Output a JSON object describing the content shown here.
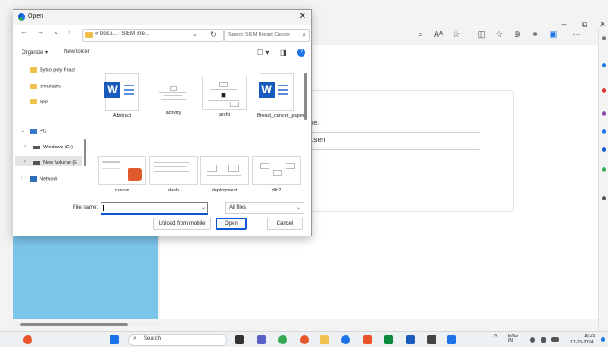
{
  "dialog": {
    "title": "Open",
    "close_glyph": "✕",
    "nav": {
      "back": "←",
      "forward": "→",
      "dropdown": "⌄",
      "up": "↑"
    },
    "address": "« Docu... › SIEM Bre...",
    "address_chevron": "⌄",
    "refresh_glyph": "↻",
    "search_placeholder": "Search SIEM Breast Cancer",
    "search_glyph": "⌕",
    "organize": "Organize ▾",
    "new_folder": "New folder",
    "view_glyphs": [
      "☐ ▾",
      "◨"
    ],
    "help_glyph": "?",
    "nav_items": [
      "Bytco poly Pract",
      "templates",
      "app",
      "PC",
      "Windows (C:)",
      "New Volume (E",
      "Network"
    ],
    "nav_chevrons": [
      "⌄",
      "›",
      "›",
      "›"
    ],
    "files": [
      {
        "name": "Abstract",
        "kind": "word"
      },
      {
        "name": "activity",
        "kind": "diagram"
      },
      {
        "name": "archi",
        "kind": "diagram"
      },
      {
        "name": "Breast_cancer_paper",
        "kind": "word"
      },
      {
        "name": "cancer",
        "kind": "slide"
      },
      {
        "name": "dash",
        "kind": "doc"
      },
      {
        "name": "deployment",
        "kind": "doc"
      },
      {
        "name": "dfd2",
        "kind": "doc"
      }
    ],
    "file_name_label": "File name:",
    "file_name_value": "",
    "file_type": "All files",
    "dropdown_glyph": "⌄",
    "upload_btn": "Upload from mobile",
    "open_btn": "Open",
    "cancel_btn": "Cancel"
  },
  "browser": {
    "controls": [
      "–",
      "⧉",
      "✕"
    ],
    "toolbar_icons": [
      "⌕",
      "Aᴬ",
      "☆",
      "◫",
      "☆",
      "⊕",
      "⚭",
      "▣",
      "⋯"
    ],
    "card_fragment": "re.",
    "input_fragment": "osen"
  },
  "taskbar": {
    "search_label": "Search",
    "search_glyph": "⌕",
    "tray_chevron": "^",
    "lang": "ENG IN",
    "time": "16:29",
    "date": "17-03-2024"
  },
  "colors": {
    "accent": "#0b57d0",
    "word": "#185abd",
    "panel": "#7cc5ea"
  }
}
